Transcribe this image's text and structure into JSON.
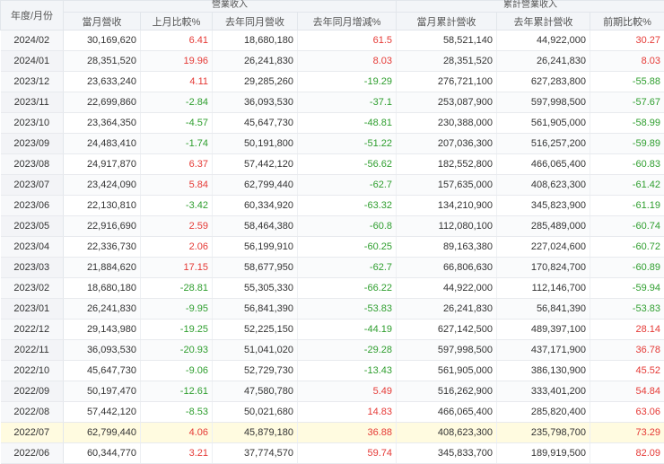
{
  "headers": {
    "date": "年度/月份",
    "group_revenue": "營業收入",
    "group_cumulative": "累計營業收入",
    "cols": [
      "當月營收",
      "上月比較%",
      "去年同月營收",
      "去年同月增減%",
      "當月累計營收",
      "去年累計營收",
      "前期比較%"
    ]
  },
  "highlight_row": "2022/07",
  "colors": {
    "positive": "#e53935",
    "negative": "#2e9e2e",
    "highlight": "#fffbe0"
  },
  "rows": [
    [
      "2024/02",
      "30,169,620",
      "6.41",
      "18,680,180",
      "61.5",
      "58,521,140",
      "44,922,000",
      "30.27"
    ],
    [
      "2024/01",
      "28,351,520",
      "19.96",
      "26,241,830",
      "8.03",
      "28,351,520",
      "26,241,830",
      "8.03"
    ],
    [
      "2023/12",
      "23,633,240",
      "4.11",
      "29,285,260",
      "-19.29",
      "276,721,100",
      "627,283,800",
      "-55.88"
    ],
    [
      "2023/11",
      "22,699,860",
      "-2.84",
      "36,093,530",
      "-37.1",
      "253,087,900",
      "597,998,500",
      "-57.67"
    ],
    [
      "2023/10",
      "23,364,350",
      "-4.57",
      "45,647,730",
      "-48.81",
      "230,388,000",
      "561,905,000",
      "-58.99"
    ],
    [
      "2023/09",
      "24,483,410",
      "-1.74",
      "50,191,800",
      "-51.22",
      "207,036,300",
      "516,257,200",
      "-59.89"
    ],
    [
      "2023/08",
      "24,917,870",
      "6.37",
      "57,442,120",
      "-56.62",
      "182,552,800",
      "466,065,400",
      "-60.83"
    ],
    [
      "2023/07",
      "23,424,090",
      "5.84",
      "62,799,440",
      "-62.7",
      "157,635,000",
      "408,623,300",
      "-61.42"
    ],
    [
      "2023/06",
      "22,130,810",
      "-3.42",
      "60,334,920",
      "-63.32",
      "134,210,900",
      "345,823,900",
      "-61.19"
    ],
    [
      "2023/05",
      "22,916,690",
      "2.59",
      "58,464,380",
      "-60.8",
      "112,080,100",
      "285,489,000",
      "-60.74"
    ],
    [
      "2023/04",
      "22,336,730",
      "2.06",
      "56,199,910",
      "-60.25",
      "89,163,380",
      "227,024,600",
      "-60.72"
    ],
    [
      "2023/03",
      "21,884,620",
      "17.15",
      "58,677,950",
      "-62.7",
      "66,806,630",
      "170,824,700",
      "-60.89"
    ],
    [
      "2023/02",
      "18,680,180",
      "-28.81",
      "55,305,330",
      "-66.22",
      "44,922,000",
      "112,146,700",
      "-59.94"
    ],
    [
      "2023/01",
      "26,241,830",
      "-9.95",
      "56,841,390",
      "-53.83",
      "26,241,830",
      "56,841,390",
      "-53.83"
    ],
    [
      "2022/12",
      "29,143,980",
      "-19.25",
      "52,225,150",
      "-44.19",
      "627,142,500",
      "489,397,100",
      "28.14"
    ],
    [
      "2022/11",
      "36,093,530",
      "-20.93",
      "51,041,020",
      "-29.28",
      "597,998,500",
      "437,171,900",
      "36.78"
    ],
    [
      "2022/10",
      "45,647,730",
      "-9.06",
      "52,729,730",
      "-13.43",
      "561,905,000",
      "386,130,900",
      "45.52"
    ],
    [
      "2022/09",
      "50,197,470",
      "-12.61",
      "47,580,780",
      "5.49",
      "516,262,900",
      "333,401,200",
      "54.84"
    ],
    [
      "2022/08",
      "57,442,120",
      "-8.53",
      "50,021,680",
      "14.83",
      "466,065,400",
      "285,820,400",
      "63.06"
    ],
    [
      "2022/07",
      "62,799,440",
      "4.06",
      "45,879,180",
      "36.88",
      "408,623,300",
      "235,798,700",
      "73.29"
    ],
    [
      "2022/06",
      "60,344,770",
      "3.21",
      "37,774,570",
      "59.74",
      "345,833,700",
      "189,919,500",
      "82.09"
    ]
  ]
}
